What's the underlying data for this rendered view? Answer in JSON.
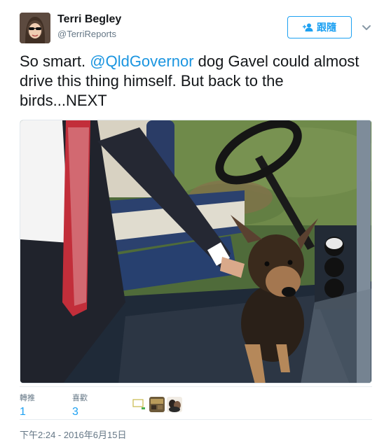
{
  "author": {
    "display_name": "Terri Begley",
    "handle": "@TerriReports"
  },
  "follow_button": {
    "label": "跟隨",
    "icon": "add-person-icon"
  },
  "tweet": {
    "text_before": "So smart. ",
    "mention": "@QldGovernor",
    "text_after": " dog Gavel could almost drive this thing himself. But back to the birds...NEXT"
  },
  "stats": {
    "retweets_label": "轉推",
    "retweets_count": "1",
    "likes_label": "喜歡",
    "likes_count": "3"
  },
  "timestamp": "下午2:24 - 2016年6月15日",
  "colors": {
    "brand_blue": "#1da1f2",
    "link_blue": "#1b95e0",
    "secondary_text": "#657786"
  }
}
